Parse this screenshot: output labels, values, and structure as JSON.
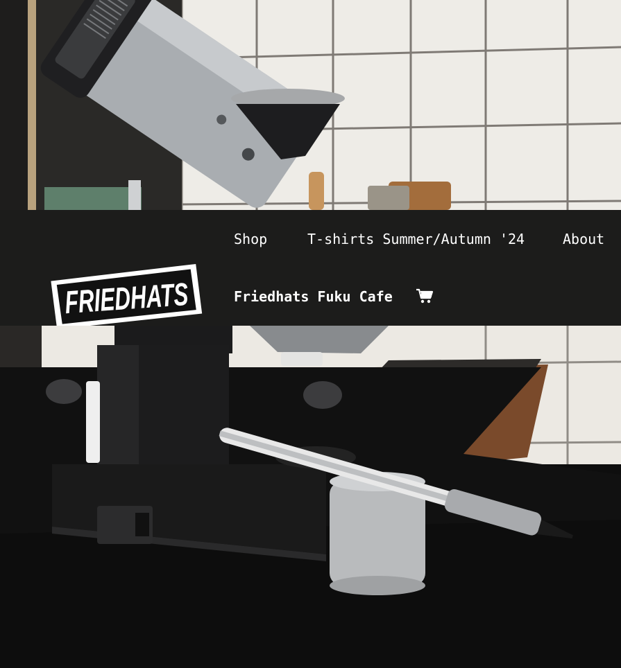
{
  "brand": {
    "logo_text": "FRIEDHATS"
  },
  "nav": {
    "items": [
      {
        "label": "Shop"
      },
      {
        "label": "T-shirts Summer/Autumn '24"
      },
      {
        "label": "About"
      },
      {
        "label": "Friedhats Fuku Cafe"
      }
    ],
    "cart_icon": "cart-icon"
  },
  "colors": {
    "header_bg": "#1c1c1b",
    "nav_text": "#ffffff",
    "logo_fill": "#ffffff",
    "logo_stroke": "#111111"
  }
}
